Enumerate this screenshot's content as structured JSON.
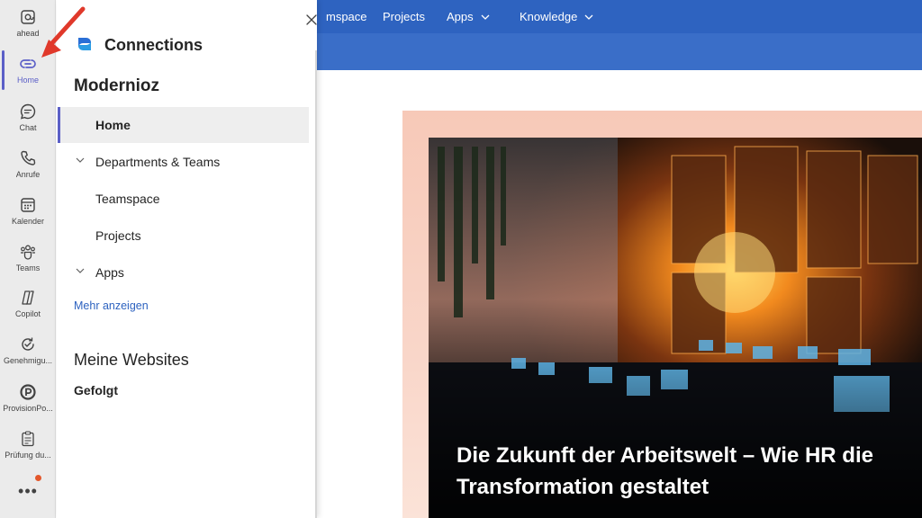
{
  "rail": {
    "items": [
      {
        "label": "ahead",
        "icon": "at-icon"
      },
      {
        "label": "Home",
        "icon": "connections-icon"
      },
      {
        "label": "Chat",
        "icon": "chat-icon"
      },
      {
        "label": "Anrufe",
        "icon": "phone-icon"
      },
      {
        "label": "Kalender",
        "icon": "calendar-icon"
      },
      {
        "label": "Teams",
        "icon": "teams-icon"
      },
      {
        "label": "Copilot",
        "icon": "copilot-icon"
      },
      {
        "label": "Genehmigu...",
        "icon": "approvals-icon"
      },
      {
        "label": "ProvisionPo...",
        "icon": "provision-icon"
      },
      {
        "label": "Prüfung du...",
        "icon": "checklist-icon"
      }
    ],
    "more": "•••",
    "accent": "#5b5fc7",
    "notification_color": "#e3572b"
  },
  "topnav": {
    "items": [
      {
        "label": "mspace",
        "has_dropdown": false
      },
      {
        "label": "Projects",
        "has_dropdown": false
      },
      {
        "label": "Apps",
        "has_dropdown": true
      },
      {
        "label": "Knowledge",
        "has_dropdown": true
      }
    ],
    "color": "#2e63c0"
  },
  "panel": {
    "title": "Connections",
    "site_name": "Modernioz",
    "nav": [
      {
        "label": "Home",
        "active": true,
        "expandable": false
      },
      {
        "label": "Departments & Teams",
        "active": false,
        "expandable": true
      },
      {
        "label": "Teamspace",
        "active": false,
        "expandable": false
      },
      {
        "label": "Projects",
        "active": false,
        "expandable": false
      },
      {
        "label": "Apps",
        "active": false,
        "expandable": true
      }
    ],
    "more_link": "Mehr anzeigen",
    "my_sites_heading": "Meine Websites",
    "followed": "Gefolgt"
  },
  "hero": {
    "title": "Die Zukunft der Arbeitswelt – Wie HR die Transformation gestaltet"
  }
}
